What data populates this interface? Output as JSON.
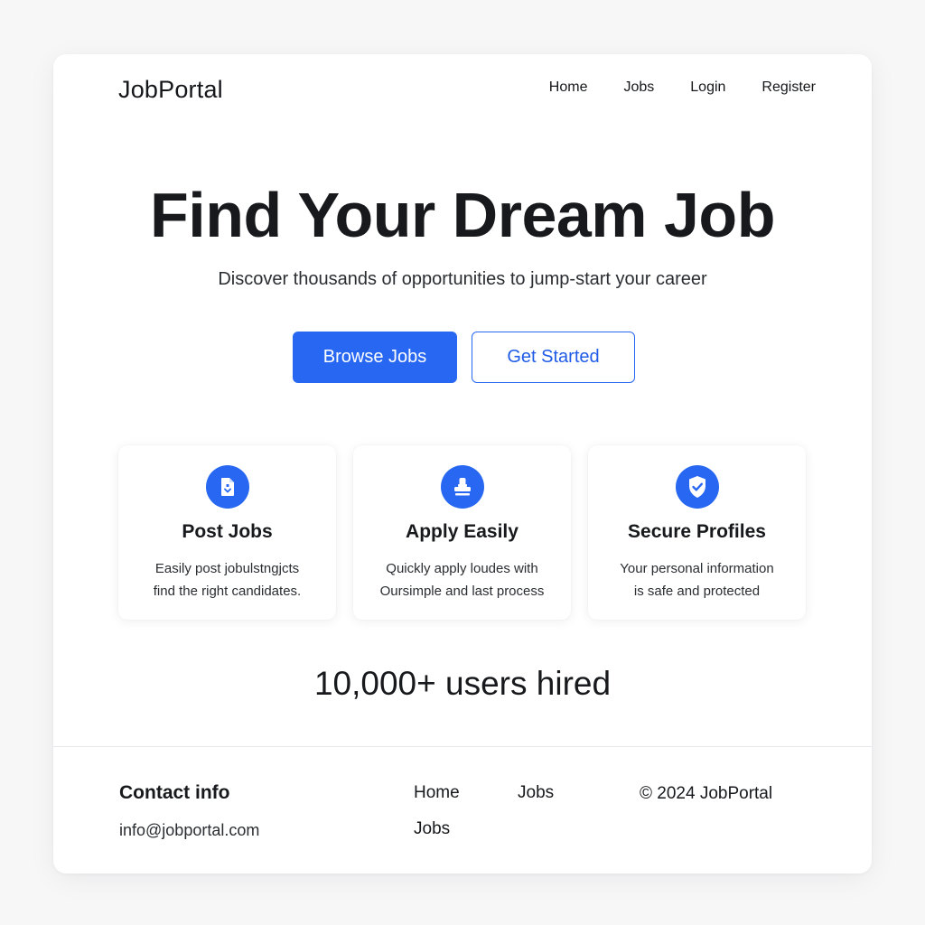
{
  "brand": {
    "name": "JobPortal",
    "accent": "#2767f1"
  },
  "nav": {
    "links": [
      "Home",
      "Jobs",
      "Login",
      "Register"
    ]
  },
  "hero": {
    "title": "Find Your Dream Job",
    "subtitle": "Discover thousands of opportunities to jump-start your career",
    "primary_button": "Browse Jobs",
    "secondary_button": "Get Started"
  },
  "features": [
    {
      "icon": "document-icon",
      "title": "Post Jobs",
      "line1": "Easily post jobulstngjcts",
      "line2": "find the right candidates."
    },
    {
      "icon": "stamp-icon",
      "title": "Apply Easily",
      "line1": "Quickly apply loudes with",
      "line2": "Oursimple and last process"
    },
    {
      "icon": "shield-check-icon",
      "title": "Secure Profiles",
      "line1": "Your personal information",
      "line2": "is safe and protected"
    }
  ],
  "stats": {
    "text": "10,000+ users hired"
  },
  "footer": {
    "contact_title": "Contact info",
    "contact_email": "info@jobportal.com",
    "links": [
      "Home",
      "Jobs",
      "Jobs"
    ],
    "copyright": "© 2024 JobPortal"
  }
}
